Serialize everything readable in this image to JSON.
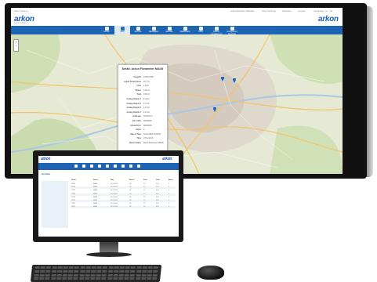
{
  "app": {
    "top_links": [
      "Arkon Hexa 1",
      "Administration Website",
      "User Settings",
      "Software",
      "Logout",
      "Language: en / de"
    ],
    "logo_text": "arkon",
    "logo_sub": "FLOW SYSTEMS"
  },
  "nav": {
    "items": [
      {
        "label": "Home",
        "icon": "home-icon"
      },
      {
        "label": "Map",
        "icon": "map-icon"
      },
      {
        "label": "Archive",
        "icon": "archive-icon"
      },
      {
        "label": "Messages",
        "icon": "envelope-icon"
      },
      {
        "label": "Results",
        "icon": "results-icon"
      },
      {
        "label": "Dashboard",
        "icon": "dashboard-icon"
      },
      {
        "label": "Flow",
        "icon": "flow-icon"
      },
      {
        "label": "Device management",
        "icon": "device-icon"
      },
      {
        "label": "Component Services",
        "icon": "services-icon"
      }
    ],
    "active_index": 1
  },
  "map": {
    "zoom_in": "+",
    "zoom_out": "−",
    "popup": {
      "title": "Detail: Arkon Flowmeter MAG8",
      "rows": [
        {
          "k": "Serial ID",
          "v": "12345 6789"
        },
        {
          "k": "Liquid Temperature",
          "v": "20.3 °C"
        },
        {
          "k": "Flow",
          "v": "2.0 l/s"
        },
        {
          "k": "Status",
          "v": "0.00 m³"
        },
        {
          "k": "Total",
          "v": "0.00 m³"
        },
        {
          "k": "Analog Output 1",
          "v": "4.0 mA"
        },
        {
          "k": "Analog Output 2",
          "v": "4.0 mA"
        },
        {
          "k": "Analog Output 3",
          "v": "4.0 mA"
        },
        {
          "k": "Analog Output 4",
          "v": "4.0 mA"
        },
        {
          "k": "Unknown",
          "v": "00:00:00 h"
        },
        {
          "k": "Error Bits",
          "v": "00000000"
        },
        {
          "k": "Actual Error",
          "v": "00000000"
        },
        {
          "k": "Alarm",
          "v": "0"
        },
        {
          "k": "Date & Time",
          "v": "01.01.2015 12:00:00"
        },
        {
          "k": "Time",
          "v": "UTC+01:00"
        },
        {
          "k": "Device Name",
          "v": "Arkon Flowmeter MAG8"
        }
      ]
    },
    "accent": "#1e64b4"
  },
  "small_screen": {
    "page_title": "Archive",
    "columns": [
      "Serial",
      "Device",
      "Date",
      "Status",
      "Flow",
      "Total",
      "Alarm"
    ],
    "rows": [
      [
        "12345",
        "MAG8",
        "01.01.2015",
        "OK",
        "2.0",
        "0.00",
        "0"
      ],
      [
        "12346",
        "MAG8",
        "01.01.2015",
        "OK",
        "2.1",
        "0.00",
        "0"
      ],
      [
        "12347",
        "MAG8",
        "01.01.2015",
        "OK",
        "1.9",
        "0.00",
        "0"
      ],
      [
        "12348",
        "MAG8",
        "01.01.2015",
        "OK",
        "2.2",
        "0.00",
        "0"
      ],
      [
        "12349",
        "MAG8",
        "01.01.2015",
        "OK",
        "2.0",
        "0.00",
        "0"
      ],
      [
        "12350",
        "MAG8",
        "01.01.2015",
        "OK",
        "1.8",
        "0.00",
        "0"
      ],
      [
        "12351",
        "MAG8",
        "01.01.2015",
        "OK",
        "2.3",
        "0.00",
        "0"
      ],
      [
        "12352",
        "MAG8",
        "01.01.2015",
        "OK",
        "2.0",
        "0.00",
        "0"
      ]
    ]
  }
}
